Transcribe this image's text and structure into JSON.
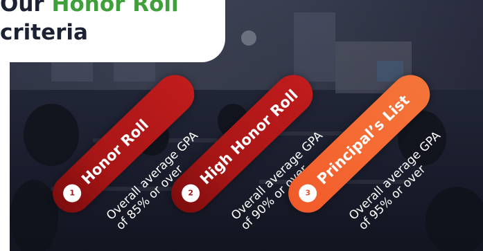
{
  "title": {
    "line1_prefix": "Our",
    "line1_accent": "Honor Roll",
    "line2": "criteria"
  },
  "colors": {
    "title_dark": "#1c2233",
    "title_accent": "#3f9f3a",
    "pill_red": "#b01818",
    "pill_orange": "#f3642f"
  },
  "criteria": [
    {
      "number": "1",
      "name": "Honor Roll",
      "desc_line1": "Overall average GPA",
      "desc_line2": "of 85% or over"
    },
    {
      "number": "2",
      "name": "High Honor Roll",
      "desc_line1": "Overall average GPA",
      "desc_line2": "of 90% or over"
    },
    {
      "number": "3",
      "name": "Principal’s List",
      "desc_line1": "Overall average GPA",
      "desc_line2": "of 95% or over"
    }
  ]
}
